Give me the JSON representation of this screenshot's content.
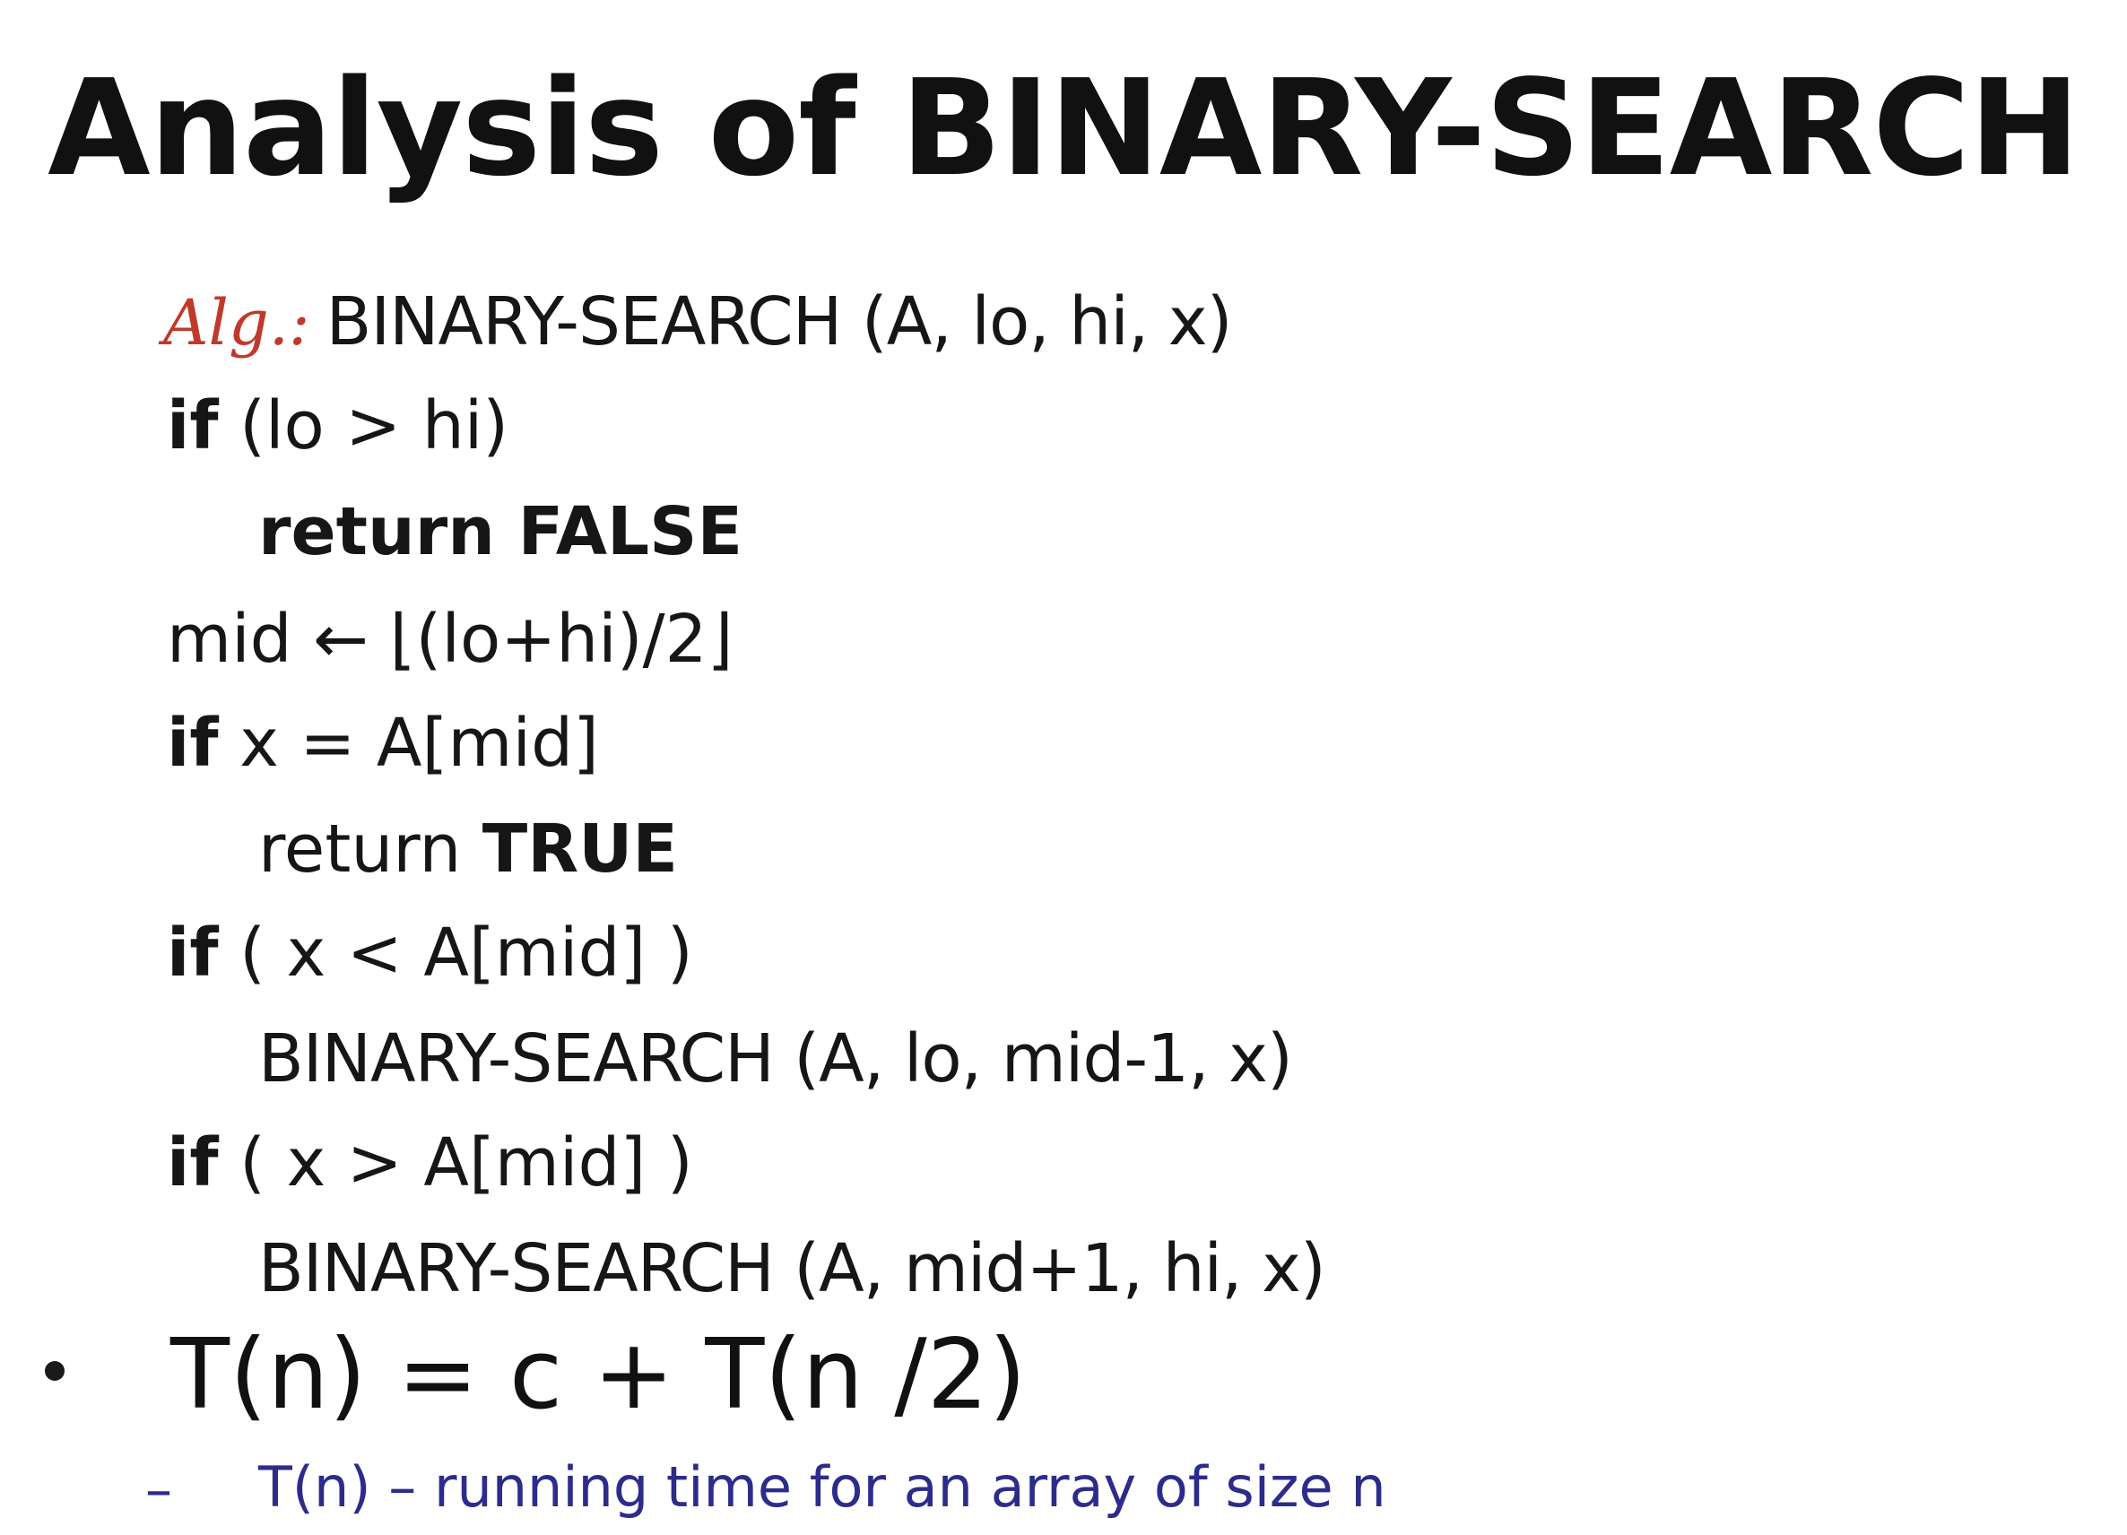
{
  "title": "Analysis of BINARY-SEARCH",
  "algorithm": {
    "label": "Alg.:",
    "signature": "BINARY-SEARCH (A, lo, hi, x)",
    "lines": [
      {
        "keyword": "if",
        "rest": " (lo > hi)"
      },
      {
        "keyword": "return FALSE",
        "rest": ""
      },
      {
        "prefix": "mid ← ⌊(lo+hi)/2⌋"
      },
      {
        "keyword": "if",
        "rest": " x = A[mid]"
      },
      {
        "prefix": "return ",
        "keyword": "TRUE"
      },
      {
        "keyword": "if",
        "rest": " ( x < A[mid] )"
      },
      {
        "prefix": "BINARY-SEARCH (A, lo, mid-1, x)"
      },
      {
        "keyword": "if",
        "rest": " ( x > A[mid] )"
      },
      {
        "prefix": "BINARY-SEARCH (A, mid+1, hi, x)"
      }
    ]
  },
  "recurrence": "T(n) = c + T(n /2)",
  "note": {
    "dash": "–",
    "text": "T(n) – running time for an array of size n"
  },
  "colors": {
    "alg_label": "#c0392b",
    "note_text": "#2c2c8c",
    "text": "#111111"
  }
}
